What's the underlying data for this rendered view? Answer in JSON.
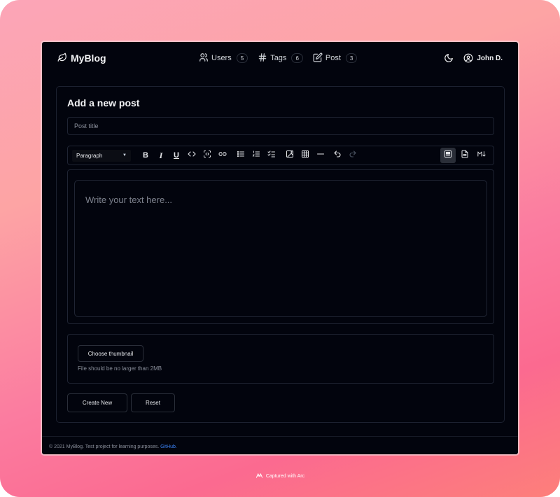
{
  "brand": {
    "name": "MyBlog",
    "icon": "leaf-icon"
  },
  "nav": {
    "items": [
      {
        "label": "Users",
        "count": "5",
        "icon": "users-icon"
      },
      {
        "label": "Tags",
        "count": "6",
        "icon": "hash-icon"
      },
      {
        "label": "Post",
        "count": "3",
        "icon": "edit-icon"
      }
    ]
  },
  "user": {
    "name": "John D.",
    "icon": "user-circle-icon"
  },
  "theme_toggle_icon": "moon-icon",
  "form": {
    "heading": "Add a new post",
    "title_placeholder": "Post title",
    "block_type": "Paragraph",
    "editor_placeholder": "Write your text here...",
    "thumbnail_button": "Choose thumbnail",
    "thumbnail_hint": "File should be no larger than 2MB",
    "create_button": "Create New",
    "reset_button": "Reset"
  },
  "footer": {
    "text": "© 2021 MyBlog. Test project for learning purposes.",
    "link": "GitHub."
  },
  "capture_note": "Captured with Arc",
  "colors": {
    "background": "#02040d",
    "border": "#1f2433",
    "link": "#3b82f6",
    "gradient_start": "#fca5b8",
    "gradient_end": "#fb6a90"
  }
}
